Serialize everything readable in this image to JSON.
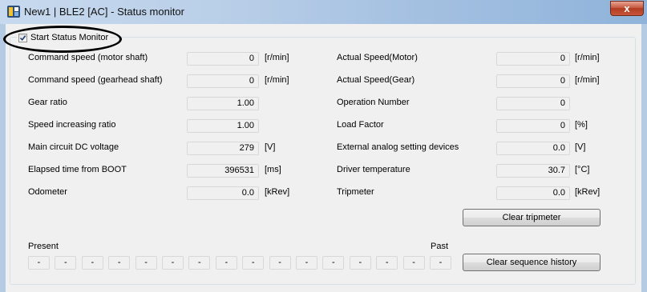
{
  "window": {
    "title": "New1 | BLE2 [AC] - Status monitor",
    "close_label": "x"
  },
  "monitor": {
    "checkbox_label": "Start Status Monitor",
    "checked": true
  },
  "left_fields": [
    {
      "label": "Command speed (motor shaft)",
      "value": "0",
      "unit": "[r/min]"
    },
    {
      "label": "Command speed (gearhead shaft)",
      "value": "0",
      "unit": "[r/min]"
    },
    {
      "label": "Gear ratio",
      "value": "1.00",
      "unit": ""
    },
    {
      "label": "Speed increasing ratio",
      "value": "1.00",
      "unit": ""
    },
    {
      "label": "Main circuit DC voltage",
      "value": "279",
      "unit": "[V]"
    },
    {
      "label": "Elapsed time from BOOT",
      "value": "396531",
      "unit": "[ms]"
    },
    {
      "label": "Odometer",
      "value": "0.0",
      "unit": "[kRev]"
    }
  ],
  "right_fields": [
    {
      "label": "Actual Speed(Motor)",
      "value": "0",
      "unit": "[r/min]"
    },
    {
      "label": "Actual Speed(Gear)",
      "value": "0",
      "unit": "[r/min]"
    },
    {
      "label": "Operation Number",
      "value": "0",
      "unit": ""
    },
    {
      "label": "Load Factor",
      "value": "0",
      "unit": "[%]"
    },
    {
      "label": "External analog setting devices",
      "value": "0.0",
      "unit": "[V]"
    },
    {
      "label": "Driver temperature",
      "value": "30.7",
      "unit": "[°C]"
    },
    {
      "label": "Tripmeter",
      "value": "0.0",
      "unit": "[kRev]"
    }
  ],
  "buttons": {
    "clear_tripmeter": "Clear tripmeter",
    "clear_sequence_history": "Clear sequence history"
  },
  "history": {
    "present_label": "Present",
    "past_label": "Past",
    "slots": [
      "-",
      "-",
      "-",
      "-",
      "-",
      "-",
      "-",
      "-",
      "-",
      "-",
      "-",
      "-",
      "-",
      "-",
      "-",
      "-"
    ]
  }
}
